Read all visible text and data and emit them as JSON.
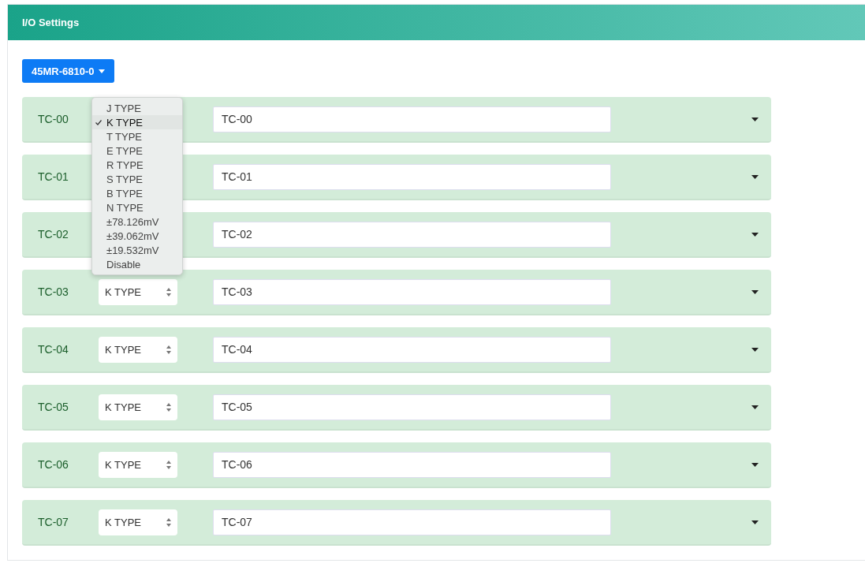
{
  "panel": {
    "title": "I/O Settings"
  },
  "device_button": {
    "label": "45MR-6810-0"
  },
  "type_menu": {
    "items": [
      {
        "label": "J TYPE",
        "selected": false
      },
      {
        "label": "K TYPE",
        "selected": true
      },
      {
        "label": "T TYPE",
        "selected": false
      },
      {
        "label": "E TYPE",
        "selected": false
      },
      {
        "label": "R TYPE",
        "selected": false
      },
      {
        "label": "S TYPE",
        "selected": false
      },
      {
        "label": "B TYPE",
        "selected": false
      },
      {
        "label": "N TYPE",
        "selected": false
      },
      {
        "label": "±78.126mV",
        "selected": false
      },
      {
        "label": "±39.062mV",
        "selected": false
      },
      {
        "label": "±19.532mV",
        "selected": false
      },
      {
        "label": "Disable",
        "selected": false
      }
    ]
  },
  "channels": [
    {
      "label": "TC-00",
      "name": "TC-00"
    },
    {
      "label": "TC-01",
      "name": "TC-01"
    },
    {
      "label": "TC-02",
      "name": "TC-02"
    },
    {
      "label": "TC-03",
      "type": "K TYPE",
      "name": "TC-03"
    },
    {
      "label": "TC-04",
      "type": "K TYPE",
      "name": "TC-04"
    },
    {
      "label": "TC-05",
      "type": "K TYPE",
      "name": "TC-05"
    },
    {
      "label": "TC-06",
      "type": "K TYPE",
      "name": "TC-06"
    },
    {
      "label": "TC-07",
      "type": "K TYPE",
      "name": "TC-07"
    }
  ]
}
